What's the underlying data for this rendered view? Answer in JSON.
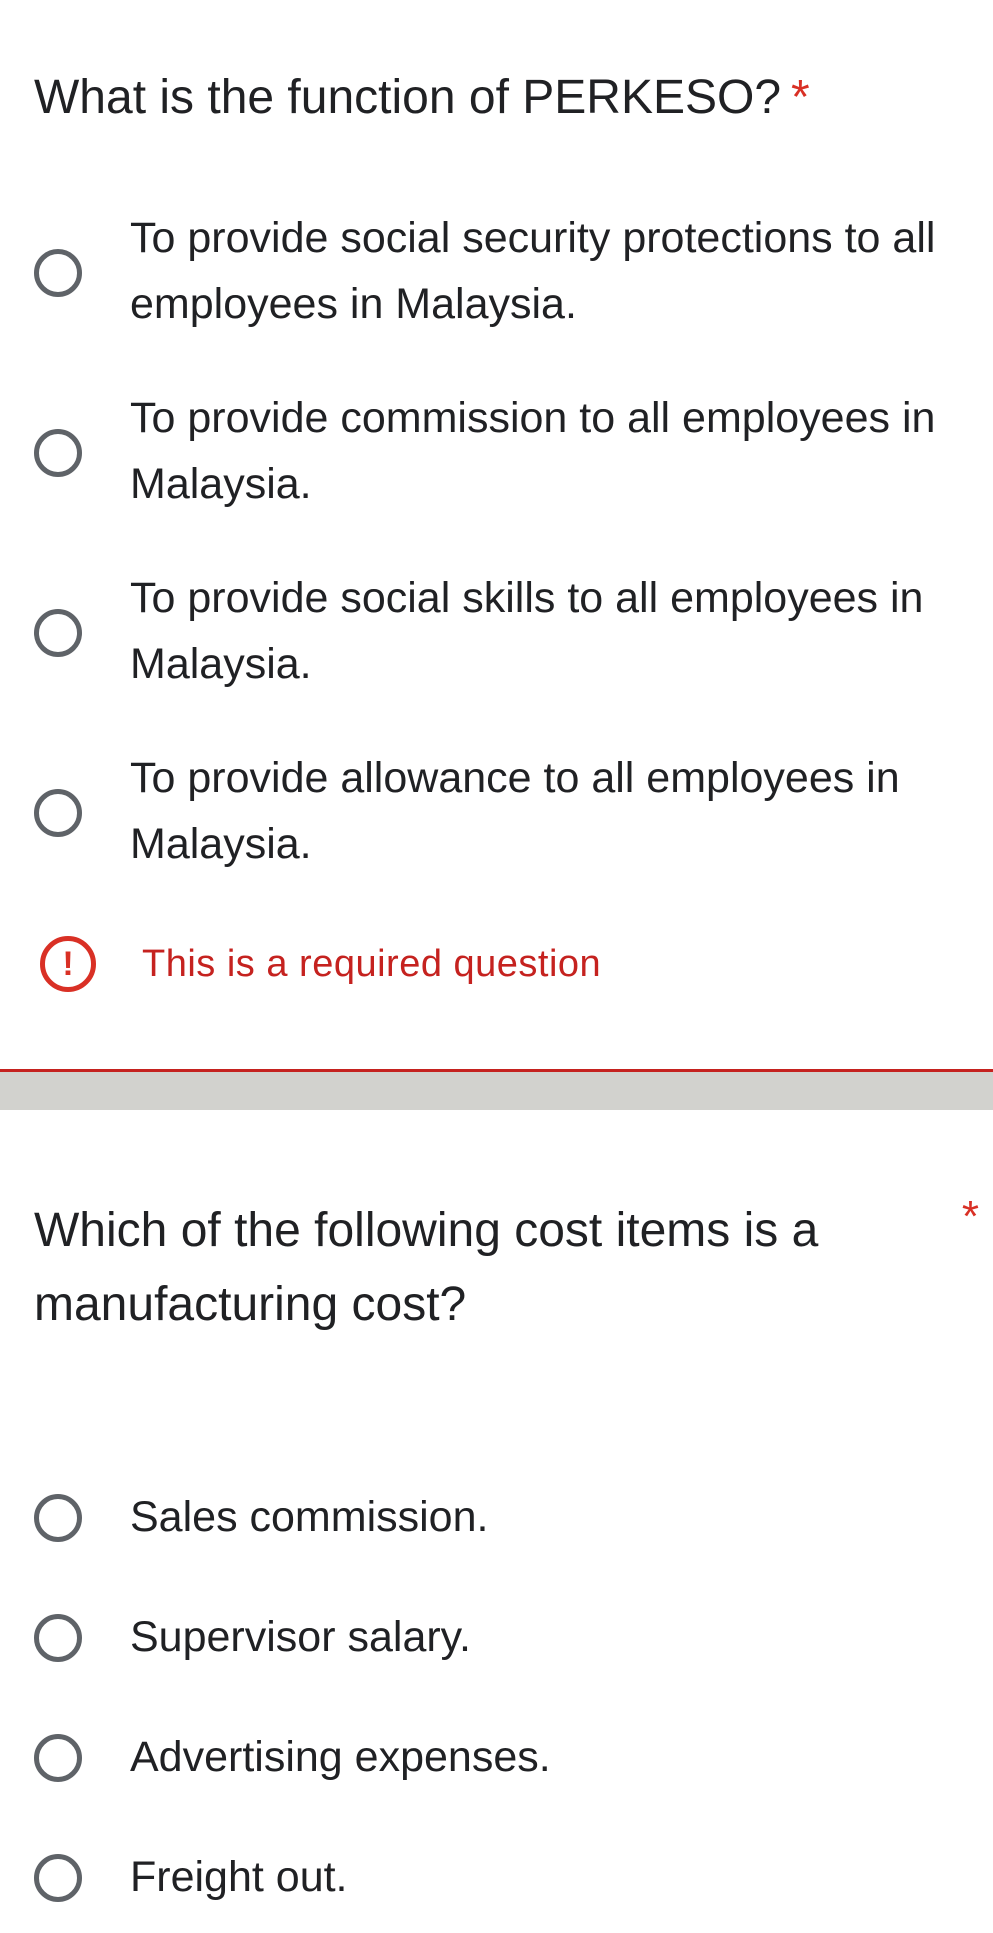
{
  "question1": {
    "title": "What is the function of PERKESO?",
    "required_marker": "*",
    "options": [
      {
        "label": "To provide social security protections to all employees in Malaysia."
      },
      {
        "label": "To provide commission to all employees in Malaysia."
      },
      {
        "label": "To provide social skills to all employees in Malaysia."
      },
      {
        "label": "To provide allowance to all employees in Malaysia."
      }
    ],
    "error": {
      "icon": "!",
      "text": "This is a required question"
    }
  },
  "question2": {
    "title": "Which of the following cost items is a manufacturing cost?",
    "required_marker": "*",
    "options": [
      {
        "label": "Sales commission."
      },
      {
        "label": "Supervisor salary."
      },
      {
        "label": "Advertising expenses."
      },
      {
        "label": "Freight out."
      }
    ]
  },
  "colors": {
    "error": "#d93025",
    "radio_border": "#5f6368",
    "separator": "#d2d2ce",
    "text": "#202124"
  },
  "icons": {
    "radio": "radio-button-unchecked-icon",
    "error": "exclamation-circle-icon"
  }
}
